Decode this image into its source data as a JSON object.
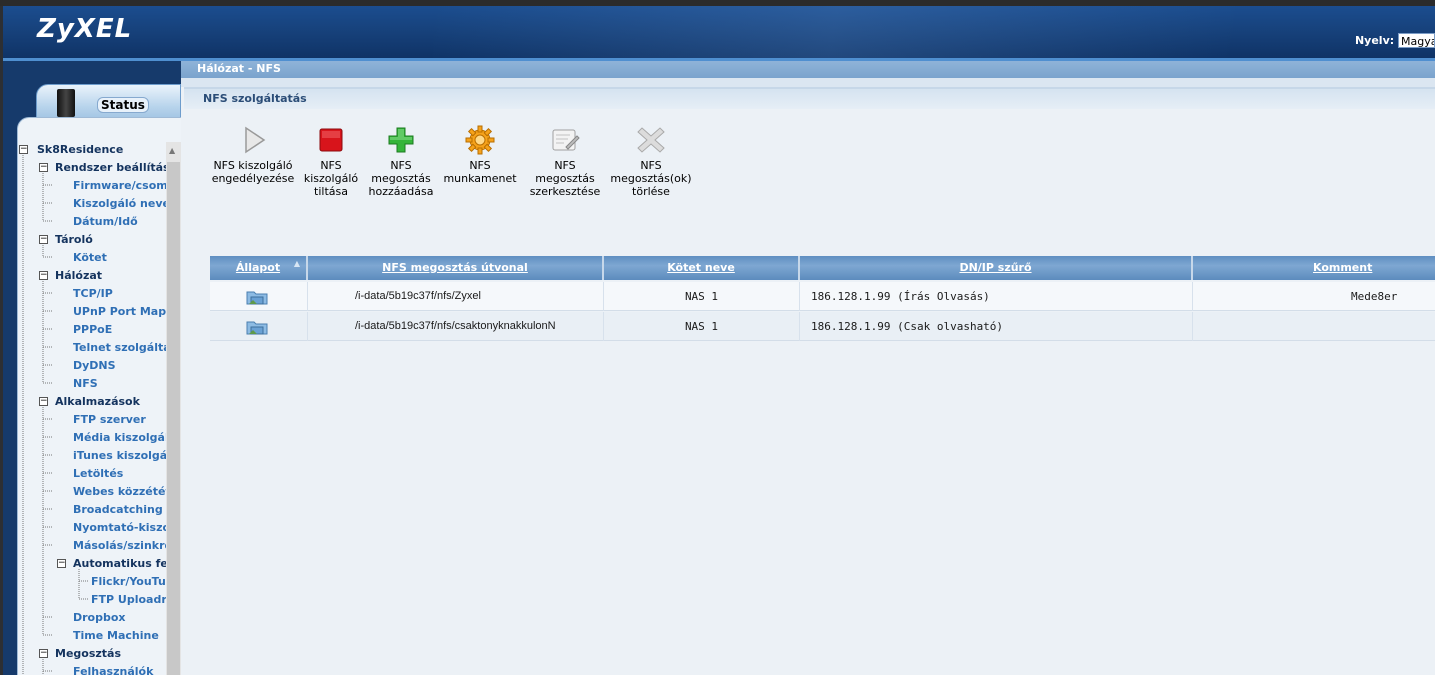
{
  "header": {
    "logo": "ZyXEL",
    "language_label": "Nyelv:",
    "language_value": "Magyar"
  },
  "sidebar": {
    "status_label": "Status",
    "tree": [
      {
        "label": "Sk8Residence",
        "level": 0,
        "toggle": "−"
      },
      {
        "label": "Rendszer beállítások",
        "level": 1,
        "toggle": "−"
      },
      {
        "label": "Firmware/csomag",
        "level": 2
      },
      {
        "label": "Kiszolgáló neve",
        "level": 2
      },
      {
        "label": "Dátum/Idő",
        "level": 2
      },
      {
        "label": "Tároló",
        "level": 1,
        "toggle": "−"
      },
      {
        "label": "Kötet",
        "level": 2
      },
      {
        "label": "Hálózat",
        "level": 1,
        "toggle": "−"
      },
      {
        "label": "TCP/IP",
        "level": 2
      },
      {
        "label": "UPnP Port Mapping",
        "level": 2
      },
      {
        "label": "PPPoE",
        "level": 2
      },
      {
        "label": "Telnet szolgáltatás",
        "level": 2
      },
      {
        "label": "DyDNS",
        "level": 2
      },
      {
        "label": "NFS",
        "level": 2
      },
      {
        "label": "Alkalmazások",
        "level": 1,
        "toggle": "−"
      },
      {
        "label": "FTP szerver",
        "level": 2
      },
      {
        "label": "Média kiszolgáló",
        "level": 2
      },
      {
        "label": "iTunes kiszolgáló",
        "level": 2
      },
      {
        "label": "Letöltés",
        "level": 2
      },
      {
        "label": "Webes közzététel",
        "level": 2
      },
      {
        "label": "Broadcatching",
        "level": 2
      },
      {
        "label": "Nyomtató-kiszolgáló",
        "level": 2
      },
      {
        "label": "Másolás/szinkronizálás",
        "level": 2
      },
      {
        "label": "Automatikus feltöltés",
        "level": 2,
        "toggle": "−"
      },
      {
        "label": "Flickr/YouTube",
        "level": 3
      },
      {
        "label": "FTP Uploadr",
        "level": 3
      },
      {
        "label": "Dropbox",
        "level": 2
      },
      {
        "label": "Time Machine",
        "level": 2
      },
      {
        "label": "Megosztás",
        "level": 1,
        "toggle": "−"
      },
      {
        "label": "Felhasználók",
        "level": 2
      }
    ]
  },
  "main": {
    "breadcrumb": "Hálózat - NFS",
    "section_title": "NFS szolgáltatás",
    "toolbar": [
      {
        "label": "NFS kiszolgáló\nengedélyezése",
        "icon": "play-icon"
      },
      {
        "label": "NFS\nkiszolgáló\ntiltása",
        "icon": "stop-icon"
      },
      {
        "label": "NFS\nmegosztás\nhozzáadása",
        "icon": "plus-icon"
      },
      {
        "label": "NFS\nmunkamenet",
        "icon": "gear-icon"
      },
      {
        "label": "NFS\nmegosztás\nszerkesztése",
        "icon": "edit-icon"
      },
      {
        "label": "NFS\nmegosztás(ok)\ntörlése",
        "icon": "delete-icon"
      }
    ],
    "table": {
      "columns": [
        "Állapot",
        "NFS megosztás útvonal",
        "Kötet neve",
        "DN/IP szűrő",
        "Komment"
      ],
      "rows": [
        {
          "path": "/i-data/5b19c37f/nfs/Zyxel",
          "volume": "NAS 1",
          "filter": "186.128.1.99 (Írás Olvasás)",
          "comment": "Mede8er"
        },
        {
          "path": "/i-data/5b19c37f/nfs/csaktonyknakkulonN",
          "volume": "NAS 1",
          "filter": "186.128.1.99 (Csak olvasható)",
          "comment": ""
        }
      ]
    }
  }
}
